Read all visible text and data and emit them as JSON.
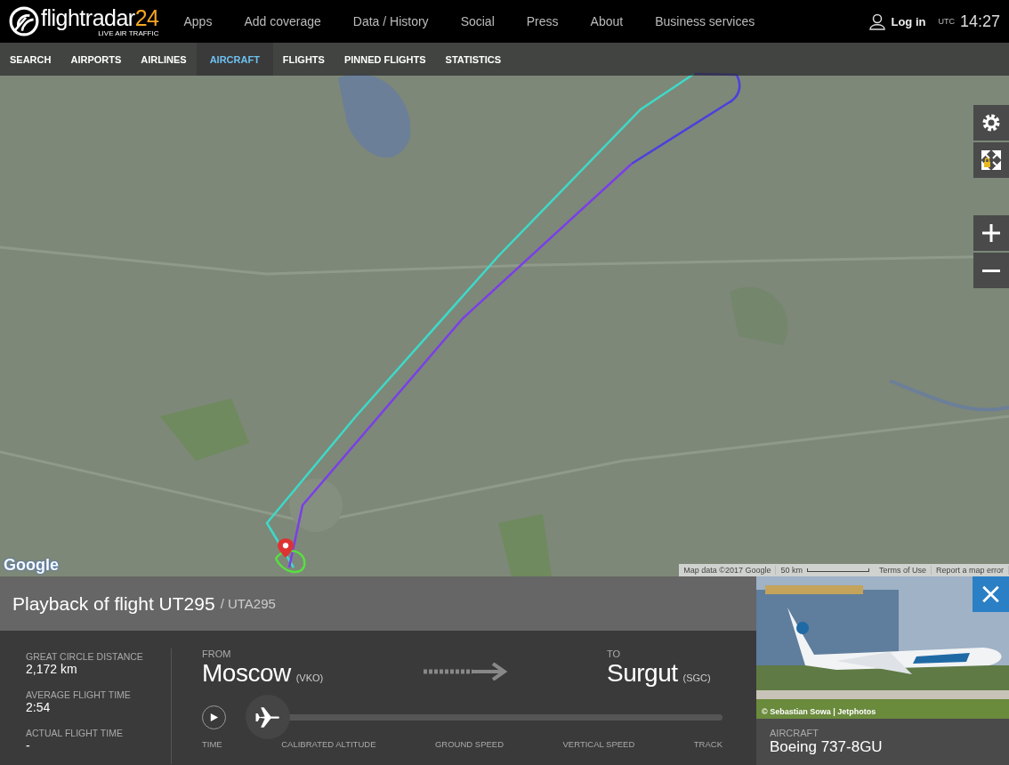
{
  "header": {
    "logo_text": "flightradar",
    "logo_number": "24",
    "tagline": "LIVE AIR TRAFFIC",
    "nav": [
      "Apps",
      "Add coverage",
      "Data / History",
      "Social",
      "Press",
      "About",
      "Business services"
    ],
    "login": "Log in",
    "utc_label": "UTC",
    "time": "14:27"
  },
  "subnav": [
    {
      "label": "SEARCH",
      "selected": false
    },
    {
      "label": "AIRPORTS",
      "selected": false
    },
    {
      "label": "AIRLINES",
      "selected": false
    },
    {
      "label": "AIRCRAFT",
      "selected": true
    },
    {
      "label": "FLIGHTS",
      "selected": false
    },
    {
      "label": "PINNED FLIGHTS",
      "selected": false
    },
    {
      "label": "STATISTICS",
      "selected": false
    }
  ],
  "map": {
    "kind": "picture",
    "google_logo": "Google",
    "attribution": "Map data ©2017 Google",
    "scale": "50 km",
    "links": [
      "Terms of Use",
      "Report a map error"
    ]
  },
  "map_controls": [
    {
      "kind": "settings"
    },
    {
      "kind": "fullscreen"
    },
    {
      "kind": "zoom_in"
    },
    {
      "kind": "zoom_out"
    }
  ],
  "flight_panel": {
    "title": "Playback of flight UT295",
    "subtitle": "/ UTA295",
    "stats": [
      {
        "label": "GREAT CIRCLE DISTANCE",
        "value": "2,172 km"
      },
      {
        "label": "AVERAGE FLIGHT TIME",
        "value": "2:54"
      },
      {
        "label": "ACTUAL FLIGHT TIME",
        "value": "-"
      }
    ],
    "from": {
      "label": "FROM",
      "city": "Moscow",
      "code": "(VKO)"
    },
    "to": {
      "label": "TO",
      "city": "Surgut",
      "code": "(SGC)"
    },
    "playback": {
      "playing": false,
      "level": 0
    },
    "columns": [
      "TIME",
      "CALIBRATED ALTITUDE",
      "GROUND SPEED",
      "VERTICAL SPEED",
      "TRACK"
    ]
  },
  "photo": {
    "kind": "picture",
    "credit": "© Sebastian Sowa | Jetphotos"
  },
  "aircraft": {
    "label": "AIRCRAFT",
    "model": "Boeing 737-8GU"
  }
}
